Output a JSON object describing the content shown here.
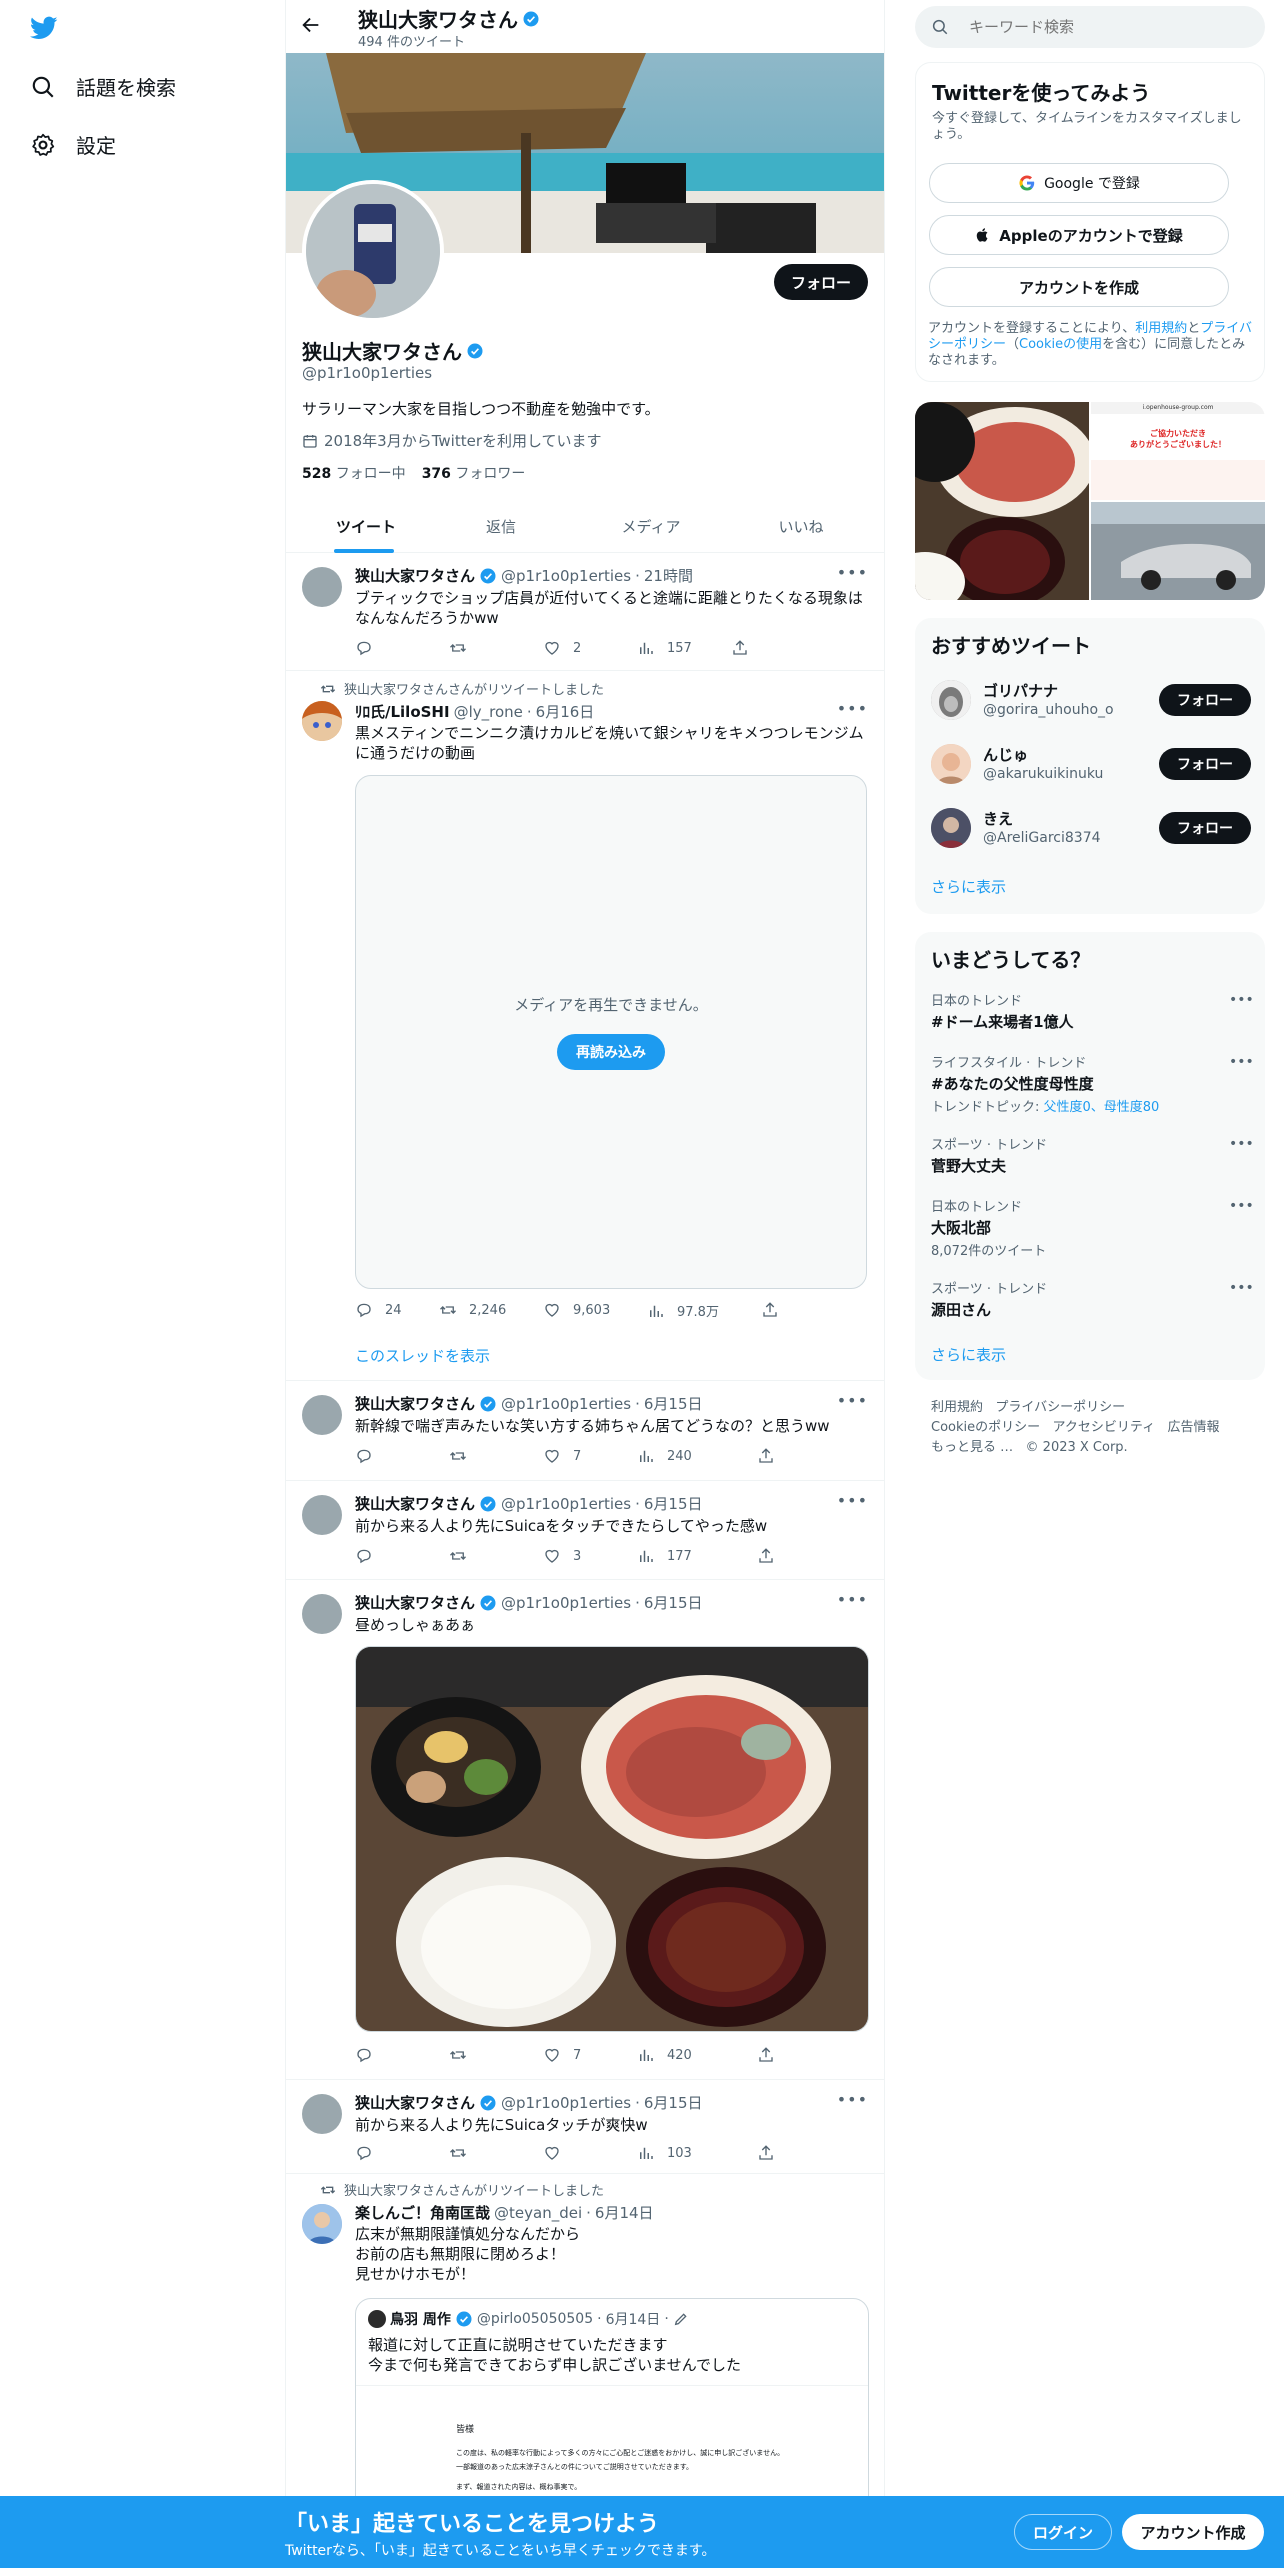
{
  "nav": {
    "explore": "話題を検索",
    "settings": "設定"
  },
  "profile": {
    "header_name": "狭山大家ワタさん",
    "tweet_count": "494 件のツイート",
    "name": "狭山大家ワタさん",
    "handle": "@p1r1o0p1erties",
    "bio": "サラリーマン大家を目指しつつ不動産を勉強中です。",
    "joined": "2018年3月からTwitterを利用しています",
    "following_count": "528",
    "following_label": "フォロー中",
    "followers_count": "376",
    "followers_label": "フォロワー",
    "follow_button": "フォロー",
    "tabs": [
      "ツイート",
      "返信",
      "メディア",
      "いいね"
    ]
  },
  "tweets": [
    {
      "name": "狭山大家ワタさん",
      "handle": "@p1r1o0p1erties",
      "time": "21時間",
      "text": "ブティックでショップ店員が近付いてくると途端に距離とりたくなる現象はなんなんだろうかww",
      "replies": "",
      "retweets": "",
      "likes": "2",
      "views": "157"
    },
    {
      "retweet_label": "狭山大家ワタさんさんがリツイートしました",
      "name": "ﾘﾛ氏/LiloSHI",
      "handle": "@ly_rone",
      "time": "6月16日",
      "text": "黒メスティンでニンニク漬けカルビを焼いて銀シャリをキメつつレモンジムに通うだけの動画",
      "media_error": "メディアを再生できません。",
      "reload": "再読み込み",
      "replies": "24",
      "retweets": "2,246",
      "likes": "9,603",
      "views": "97.8万",
      "thread_link": "このスレッドを表示"
    },
    {
      "name": "狭山大家ワタさん",
      "handle": "@p1r1o0p1erties",
      "time": "6月15日",
      "text": "新幹線で喘ぎ声みたいな笑い方する姉ちゃん居てどうなの？と思うww",
      "replies": "",
      "retweets": "",
      "likes": "7",
      "views": "240"
    },
    {
      "name": "狭山大家ワタさん",
      "handle": "@p1r1o0p1erties",
      "time": "6月15日",
      "text": "前から来る人より先にSuicaをタッチできたらしてやった感w",
      "replies": "",
      "retweets": "",
      "likes": "3",
      "views": "177"
    },
    {
      "name": "狭山大家ワタさん",
      "handle": "@p1r1o0p1erties",
      "time": "6月15日",
      "text": "昼めっしゃぁあぁ",
      "replies": "",
      "retweets": "",
      "likes": "7",
      "views": "420"
    },
    {
      "name": "狭山大家ワタさん",
      "handle": "@p1r1o0p1erties",
      "time": "6月15日",
      "text": "前から来る人より先にSuicaタッチが爽快w",
      "replies": "",
      "retweets": "",
      "likes": "",
      "views": "103"
    },
    {
      "retweet_label": "狭山大家ワタさんさんがリツイートしました",
      "name": "楽しんご！角南匡哉",
      "handle": "@teyan_dei",
      "time": "6月14日",
      "text_lines": [
        "広末が無期限謹慎処分なんだから",
        "お前の店も無期限に閉めろよ！",
        "見せかけホモが！"
      ],
      "quote": {
        "name": "鳥羽 周作",
        "handle": "@pirlo05050505",
        "time": "6月14日",
        "text_lines": [
          "報道に対して正直に説明させていただきます",
          "今まで何も発言できておらず申し訳ございませんでした"
        ],
        "doc_title": "皆様",
        "doc_lines": [
          "この度は、私の軽率な行動によって多くの方々にご心配とご迷惑をおかけし、誠に申し訳ございません。",
          "一部報道のあった広末涼子さんとの件についてご説明させていただきます。",
          "まず、報道された内容は、概ね事実で。"
        ]
      }
    }
  ],
  "right": {
    "search_placeholder": "キーワード検索",
    "signup": {
      "title": "Twitterを使ってみよう",
      "subtitle": "今すぐ登録して、タイムラインをカスタマイズしましょう。",
      "google": "Google で登録",
      "apple": "Appleのアカウントで登録",
      "create": "アカウントを作成",
      "terms_pre": "アカウントを登録することにより、",
      "terms_link1": "利用規約",
      "terms_mid1": "と",
      "terms_link2": "プライバシーポリシー",
      "terms_mid2": "（",
      "terms_link3": "Cookieの使用",
      "terms_post": "を含む）に同意したとみなされます。"
    },
    "media_grid": {
      "phone_url": "i.openhouse-group.com",
      "phone_banner_1": "ご協力いただき",
      "phone_banner_2": "ありがとうございました！"
    },
    "who_to_follow": {
      "title": "おすすめツイート",
      "users": [
        {
          "name": "ゴリパナナ",
          "handle": "@gorira_uhouho_o",
          "button": "フォロー"
        },
        {
          "name": "んじゅ",
          "handle": "@akarukuikinuku",
          "button": "フォロー"
        },
        {
          "name": "きえ",
          "handle": "@AreliGarci8374",
          "button": "フォロー"
        }
      ],
      "show_more": "さらに表示"
    },
    "trends": {
      "title": "いまどうしてる？",
      "items": [
        {
          "category": "日本のトレンド",
          "name": "#ドーム来場者1億人",
          "sub": ""
        },
        {
          "category": "ライフスタイル · トレンド",
          "name": "#あなたの父性度母性度",
          "sub_pre": "トレンドトピック: ",
          "sub_links": "父性度0、母性度80"
        },
        {
          "category": "スポーツ · トレンド",
          "name": "菅野大丈夫",
          "sub": ""
        },
        {
          "category": "日本のトレンド",
          "name": "大阪北部",
          "sub": "8,072件のツイート"
        },
        {
          "category": "スポーツ · トレンド",
          "name": "源田さん",
          "sub": ""
        }
      ],
      "show_more": "さらに表示"
    },
    "footer": [
      "利用規約",
      "プライバシーポリシー",
      "Cookieのポリシー",
      "アクセシビリティ",
      "広告情報",
      "もっと見る …",
      "© 2023 X Corp."
    ]
  },
  "bottom_bar": {
    "title": "「いま」起きていることを見つけよう",
    "subtitle": "Twitterなら、「いま」起きていることをいち早くチェックできます。",
    "login": "ログイン",
    "signup": "アカウント作成"
  },
  "colors": {
    "accent": "#1d9bf0",
    "text": "#0f1419",
    "secondary": "#536471",
    "border": "#eff3f4"
  }
}
